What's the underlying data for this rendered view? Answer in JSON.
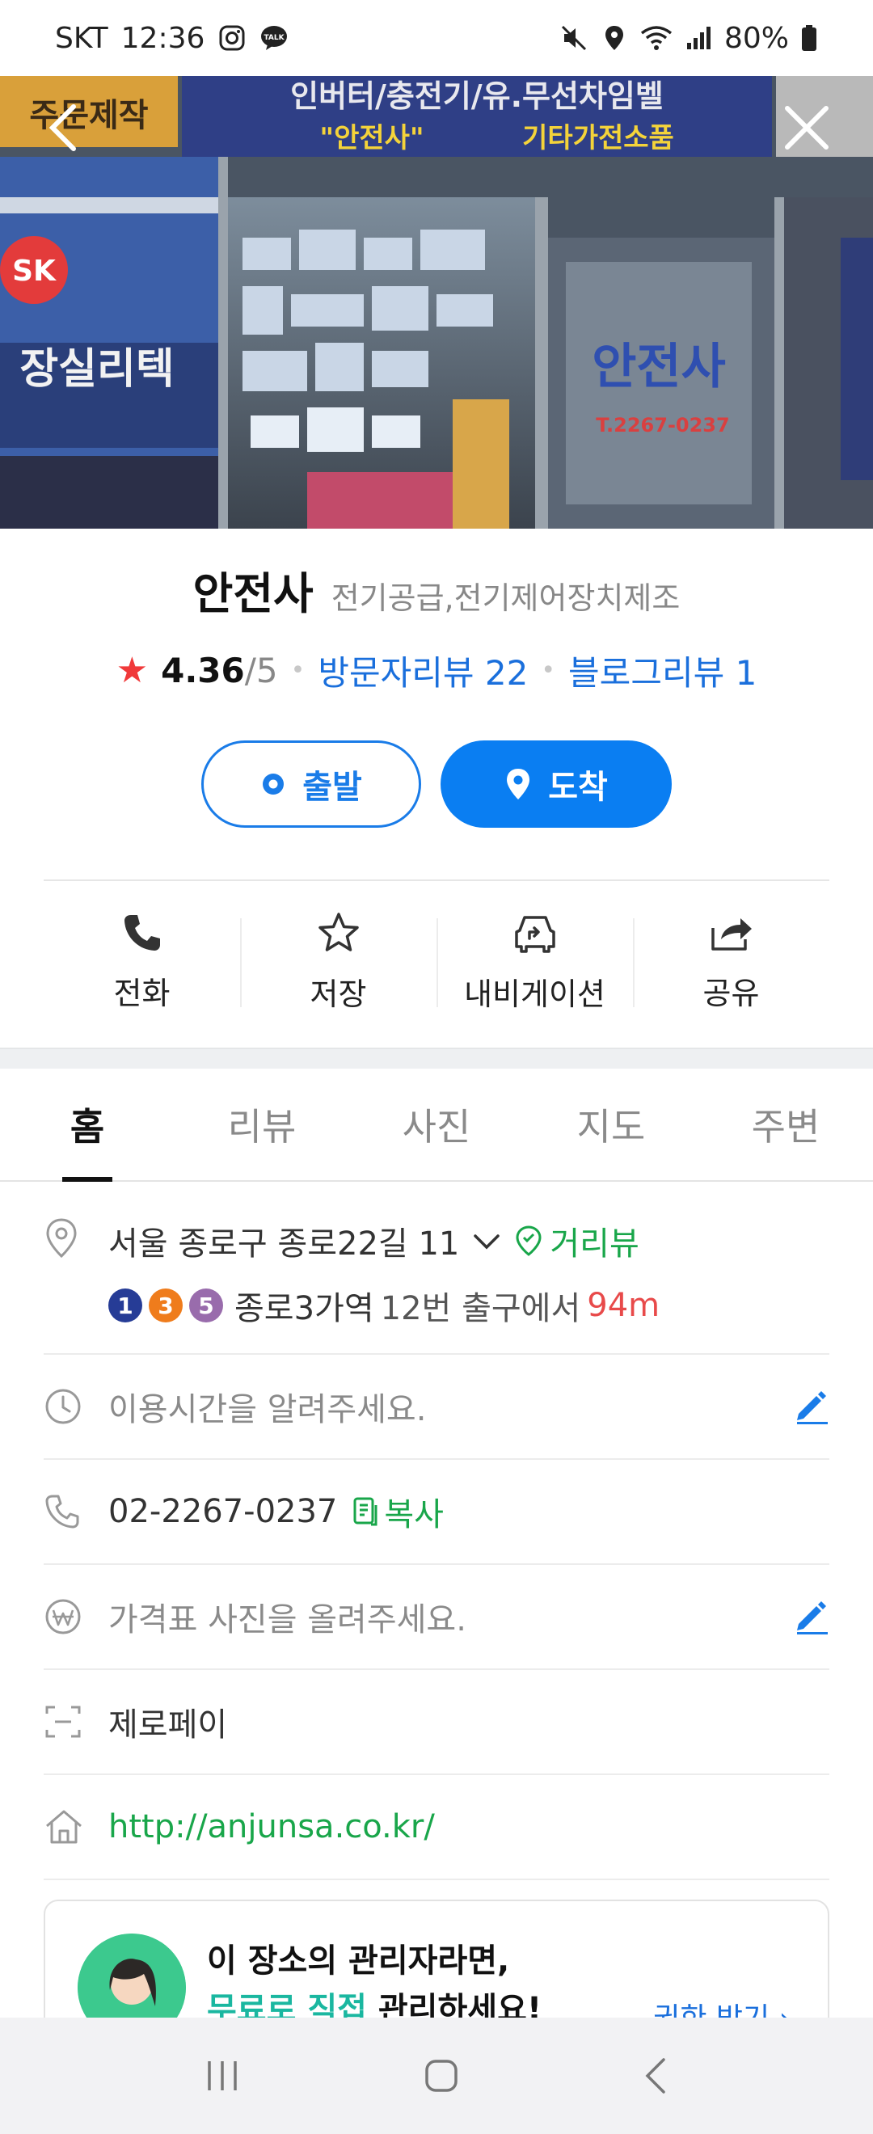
{
  "status_bar": {
    "carrier": "SKT",
    "time": "12:36",
    "battery": "80%",
    "icons_left": [
      "instagram-icon",
      "kakaotalk-icon"
    ],
    "icons_right": [
      "mute-icon",
      "location-icon",
      "wifi-icon",
      "signal-icon",
      "battery-icon"
    ]
  },
  "hero": {
    "photo_signs": {
      "top_sign": "인버터/충전기/유.무선차임벨",
      "top_sign_2": "\"안전사\"",
      "top_sign_3": "기타가전소품",
      "left_sign": "주문제작",
      "left_brand": "SK",
      "left_shop": "장실리텍",
      "window_name": "안전사",
      "window_phone": "T.2267-0237"
    }
  },
  "place": {
    "name": "안전사",
    "category": "전기공급,전기제어장치제조",
    "rating": "4.36",
    "rating_max": "/5",
    "visitor_reviews": "방문자리뷰 22",
    "blog_reviews": "블로그리뷰 1"
  },
  "route": {
    "depart_label": "출발",
    "arrive_label": "도착"
  },
  "actions": [
    {
      "label": "전화",
      "icon": "phone-icon"
    },
    {
      "label": "저장",
      "icon": "star-icon"
    },
    {
      "label": "내비게이션",
      "icon": "navigation-icon"
    },
    {
      "label": "공유",
      "icon": "share-icon"
    }
  ],
  "tabs": [
    {
      "label": "홈",
      "active": true
    },
    {
      "label": "리뷰",
      "active": false
    },
    {
      "label": "사진",
      "active": false
    },
    {
      "label": "지도",
      "active": false
    },
    {
      "label": "주변",
      "active": false
    }
  ],
  "info": {
    "address": "서울 종로구 종로22길 11",
    "street_view": "거리뷰",
    "subway_lines": [
      {
        "num": "1",
        "color": "#263c96"
      },
      {
        "num": "3",
        "color": "#ef7c1c"
      },
      {
        "num": "5",
        "color": "#996cac"
      }
    ],
    "station": "종로3가역",
    "exit": "12번 출구에서",
    "distance": "94m",
    "hours_placeholder": "이용시간을 알려주세요.",
    "phone": "02-2267-0237",
    "copy_label": "복사",
    "price_placeholder": "가격표 사진을 올려주세요.",
    "zeropay": "제로페이",
    "website": "http://anjunsa.co.kr/"
  },
  "owner_card": {
    "line1": "이 장소의 관리자라면,",
    "line2_green": "무료로 직접",
    "line2_rest": " 관리하세요!",
    "link": "권한 받기 ›"
  },
  "colors": {
    "accent_blue": "#0a7ef2",
    "link_blue": "#1a6fdc",
    "green": "#19a64a",
    "red_star": "#f0393a"
  }
}
